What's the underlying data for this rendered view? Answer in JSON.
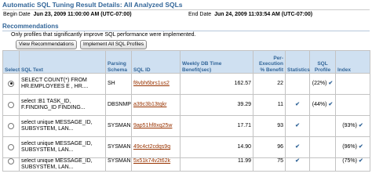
{
  "page": {
    "title": "Automatic SQL Tuning Result Details: All Analyzed SQLs",
    "begin_date_label": "Begin Date",
    "begin_date": "Jun 23, 2009 11:00:00 AM (UTC-07:00)",
    "end_date_label": "End Date",
    "end_date": "Jun 24, 2009 11:03:54 AM (UTC-07:00)"
  },
  "recommendations": {
    "heading": "Recommendations",
    "note": "Only profiles that significantly improve SQL performance were implemented.",
    "view_button": "View Recommendations",
    "implement_button": "Implement All SQL Profiles"
  },
  "table": {
    "headers": {
      "select": "Select",
      "sql_text": "SQL Text",
      "schema": "Parsing Schema",
      "sql_id": "SQL ID",
      "benefit": "Weekly DB Time Benefit(sec)",
      "per_exec": "Per-Execution % Benefit",
      "statistics": "Statistics",
      "sql_profile": "SQL Profile",
      "index": "Index"
    },
    "rows": [
      {
        "selected": true,
        "sql_text": "SELECT COUNT(*) FROM HR.EMPLOYEES E , HR....",
        "schema": "SH",
        "sql_id": "f8vbh6brs1us2",
        "benefit": "162.57",
        "per_exec": "22",
        "statistics": "",
        "sql_profile": "(22%)",
        "index": ""
      },
      {
        "selected": false,
        "sql_text": "select :B1 TASK_ID, F.FINDING_ID FINDING...",
        "schema": "DBSNMP",
        "sql_id": "a39c3b13tqkr",
        "benefit": "39.29",
        "per_exec": "11",
        "statistics": "yes",
        "sql_profile": "(44%)",
        "index": ""
      },
      {
        "selected": false,
        "sql_text": "select unique MESSAGE_ID, SUBSYSTEM, LAN...",
        "schema": "SYSMAN",
        "sql_id": "9ap51hf8xq25w",
        "benefit": "17.71",
        "per_exec": "93",
        "statistics": "yes",
        "sql_profile": "",
        "index": "(93%)"
      },
      {
        "selected": false,
        "sql_text": "select unique MESSAGE_ID, SUBSYSTEM, LAN...",
        "schema": "SYSMAN",
        "sql_id": "49c4ct2cdqs9q",
        "benefit": "14.90",
        "per_exec": "96",
        "statistics": "yes",
        "sql_profile": "",
        "index": "(96%)"
      },
      {
        "selected": false,
        "sql_text": "select unique MESSAGE_ID, SUBSYSTEM, LAN...",
        "schema": "SYSMAN",
        "sql_id": "5x51k74v2t62k",
        "benefit": "11.99",
        "per_exec": "75",
        "statistics": "yes",
        "sql_profile": "",
        "index": "(75%)"
      }
    ]
  },
  "icons": {
    "check": "checkmark-icon"
  },
  "colors": {
    "header_text": "#336699",
    "header_bg": "#cfe0f1",
    "link": "#993300"
  }
}
